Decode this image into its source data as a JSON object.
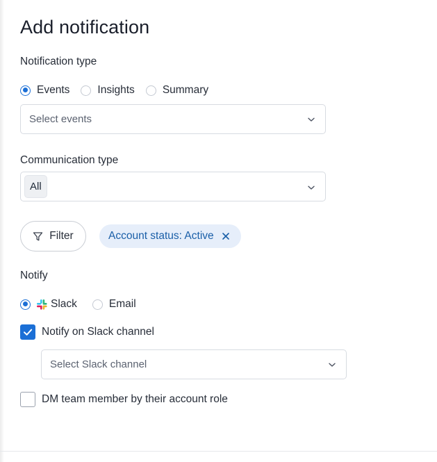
{
  "dialog": {
    "title": "Add notification"
  },
  "notification_type": {
    "label": "Notification type",
    "options": [
      {
        "label": "Events",
        "selected": true
      },
      {
        "label": "Insights",
        "selected": false
      },
      {
        "label": "Summary",
        "selected": false
      }
    ],
    "events_select": {
      "placeholder": "Select events",
      "icon": "chevron-down-icon"
    }
  },
  "communication_type": {
    "label": "Communication type",
    "selected_tag": "All",
    "icon": "chevron-down-icon"
  },
  "filter": {
    "button_label": "Filter",
    "button_icon": "filter-icon",
    "chips": [
      {
        "label": "Account status: Active",
        "remove_icon": "close-icon"
      }
    ]
  },
  "notify": {
    "label": "Notify",
    "options": [
      {
        "label": "Slack",
        "selected": true,
        "icon": "slack-logo-icon"
      },
      {
        "label": "Email",
        "selected": false
      }
    ],
    "slack_channel_checkbox": {
      "label": "Notify on Slack channel",
      "checked": true
    },
    "slack_channel_select": {
      "placeholder": "Select Slack channel",
      "icon": "chevron-down-icon"
    },
    "dm_checkbox": {
      "label": "DM team member by their account role",
      "checked": false
    }
  },
  "colors": {
    "accent": "#1b6fd6",
    "chip_bg": "#e6eefa",
    "chip_text": "#1a5fa8",
    "border": "#d7dbe1"
  }
}
